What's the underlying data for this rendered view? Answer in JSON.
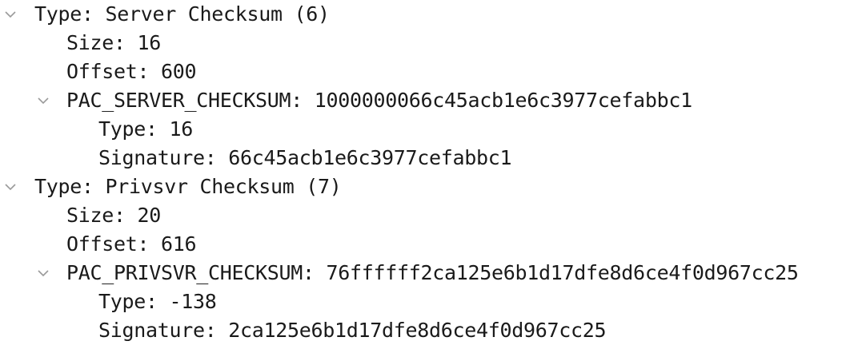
{
  "tree": {
    "rows": [
      {
        "text": "Type: Server Checksum (6)",
        "expanded": true,
        "level": 0
      },
      {
        "text": "Size: 16",
        "level": 1
      },
      {
        "text": "Offset: 600",
        "level": 1
      },
      {
        "text": "PAC_SERVER_CHECKSUM: 1000000066c45acb1e6c3977cefabbc1",
        "expanded": true,
        "level": 1
      },
      {
        "text": "Type: 16",
        "level": 2
      },
      {
        "text": "Signature: 66c45acb1e6c3977cefabbc1",
        "level": 2
      },
      {
        "text": "Type: Privsvr Checksum (7)",
        "expanded": true,
        "level": 0
      },
      {
        "text": "Size: 20",
        "level": 1
      },
      {
        "text": "Offset: 616",
        "level": 1
      },
      {
        "text": "PAC_PRIVSVR_CHECKSUM: 76ffffff2ca125e6b1d17dfe8d6ce4f0d967cc25",
        "expanded": true,
        "level": 1
      },
      {
        "text": "Type: -138",
        "level": 2
      },
      {
        "text": "Signature: 2ca125e6b1d17dfe8d6ce4f0d967cc25",
        "level": 2
      }
    ]
  },
  "icons": {
    "expand_chevron": "chevron-down-icon"
  },
  "colors": {
    "text": "#1a1a1a",
    "chevron": "#9a9a9a",
    "background": "#ffffff"
  }
}
